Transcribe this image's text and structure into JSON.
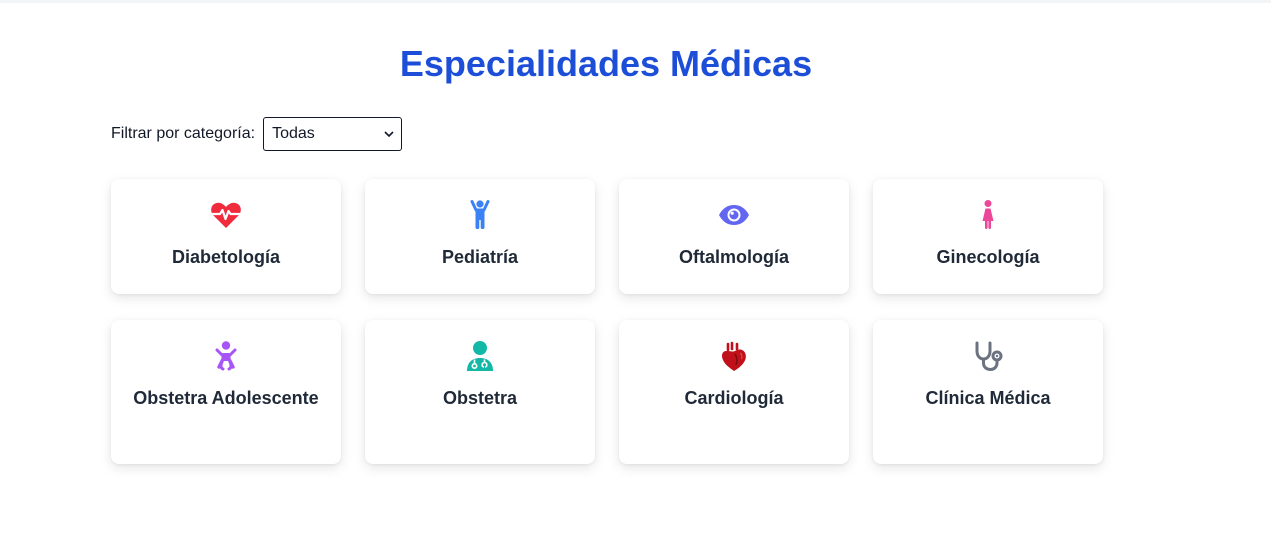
{
  "page": {
    "title": "Especialidades Médicas"
  },
  "filter": {
    "label": "Filtrar por categoría:",
    "selected": "Todas"
  },
  "specialties": [
    {
      "label": "Diabetología",
      "icon": "heartbeat-icon",
      "color": "#ef2b3c"
    },
    {
      "label": "Pediatría",
      "icon": "child-icon",
      "color": "#3b82f6"
    },
    {
      "label": "Oftalmología",
      "icon": "eye-icon",
      "color": "#6366f1"
    },
    {
      "label": "Ginecología",
      "icon": "female-icon",
      "color": "#ec4899"
    },
    {
      "label": "Obstetra Adolescente",
      "icon": "baby-icon",
      "color": "#a855f7"
    },
    {
      "label": "Obstetra",
      "icon": "user-doctor-icon",
      "color": "#14b8a6"
    },
    {
      "label": "Cardiología",
      "icon": "heart-organ-icon",
      "color": "#c0101a"
    },
    {
      "label": "Clínica Médica",
      "icon": "stethoscope-icon",
      "color": "#6b7280"
    }
  ]
}
